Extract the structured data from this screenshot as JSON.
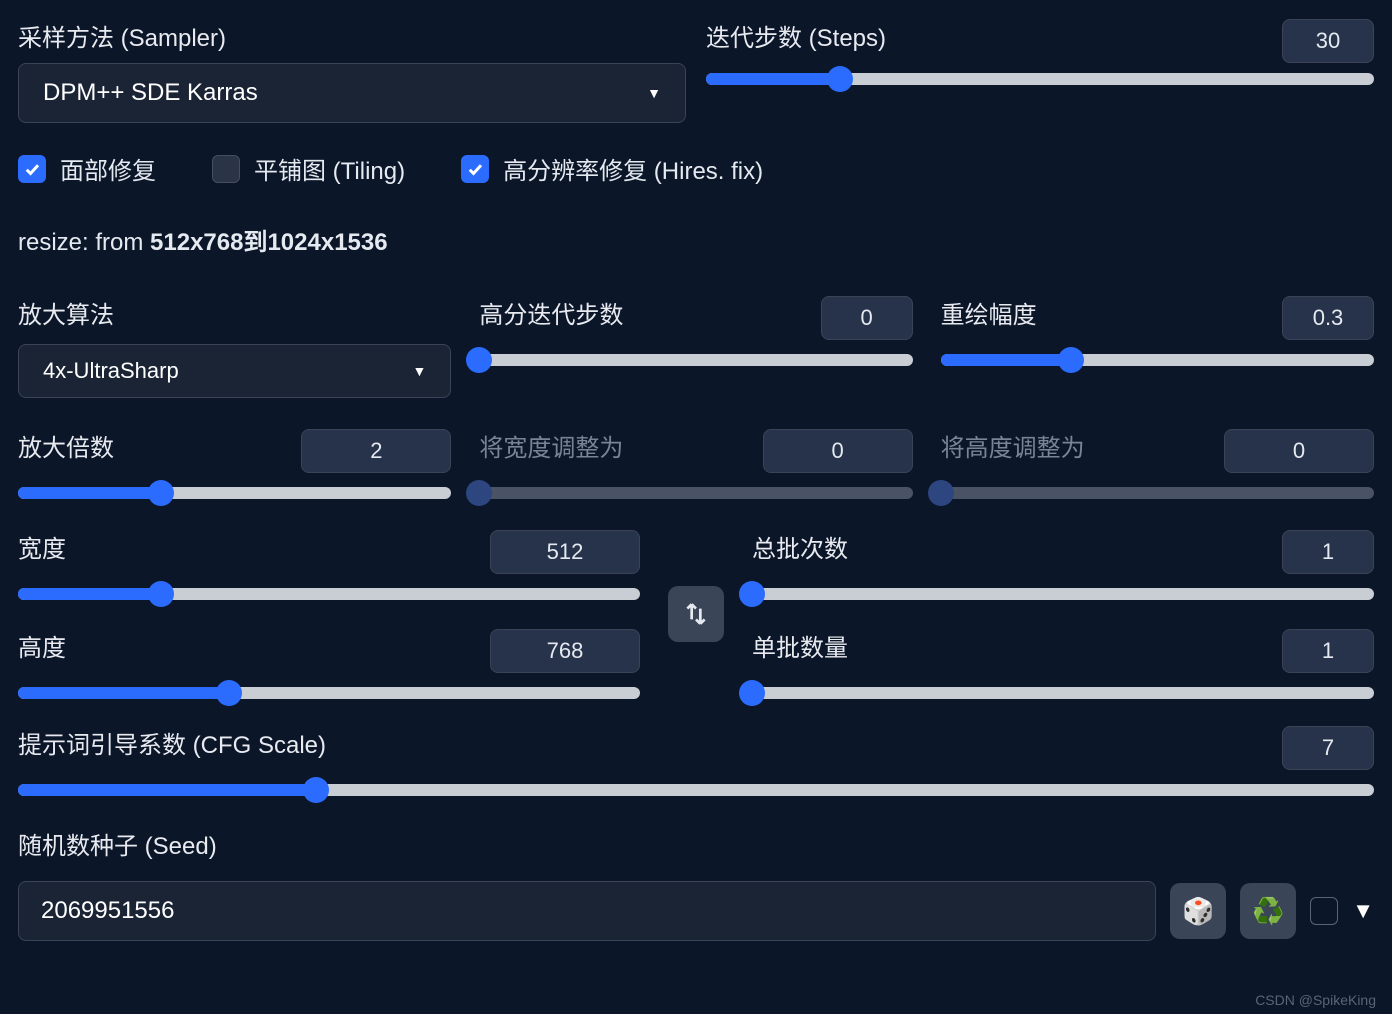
{
  "sampler": {
    "label": "采样方法 (Sampler)",
    "value": "DPM++ SDE Karras"
  },
  "steps": {
    "label": "迭代步数 (Steps)",
    "value": "30",
    "pct": 20
  },
  "checks": {
    "face": {
      "label": "面部修复",
      "on": true
    },
    "tiling": {
      "label": "平铺图 (Tiling)",
      "on": false
    },
    "hires": {
      "label": "高分辨率修复 (Hires. fix)",
      "on": true
    }
  },
  "resize": {
    "prefix": "resize: from ",
    "bold": "512x768到1024x1536"
  },
  "upscaler": {
    "label": "放大算法",
    "value": "4x-UltraSharp"
  },
  "hires_steps": {
    "label": "高分迭代步数",
    "value": "0",
    "pct": 0
  },
  "denoise": {
    "label": "重绘幅度",
    "value": "0.3",
    "pct": 30
  },
  "upscale_by": {
    "label": "放大倍数",
    "value": "2",
    "pct": 33
  },
  "resize_w": {
    "label": "将宽度调整为",
    "value": "0",
    "pct": 0
  },
  "resize_h": {
    "label": "将高度调整为",
    "value": "0",
    "pct": 0
  },
  "width": {
    "label": "宽度",
    "value": "512",
    "pct": 23
  },
  "height": {
    "label": "高度",
    "value": "768",
    "pct": 34
  },
  "batch_count": {
    "label": "总批次数",
    "value": "1",
    "pct": 0
  },
  "batch_size": {
    "label": "单批数量",
    "value": "1",
    "pct": 0
  },
  "cfg": {
    "label": "提示词引导系数 (CFG Scale)",
    "value": "7",
    "pct": 22
  },
  "seed": {
    "label": "随机数种子 (Seed)",
    "value": "2069951556"
  },
  "icons": {
    "dice": "🎲",
    "recycle": "♻️"
  },
  "watermark": "CSDN @SpikeKing"
}
